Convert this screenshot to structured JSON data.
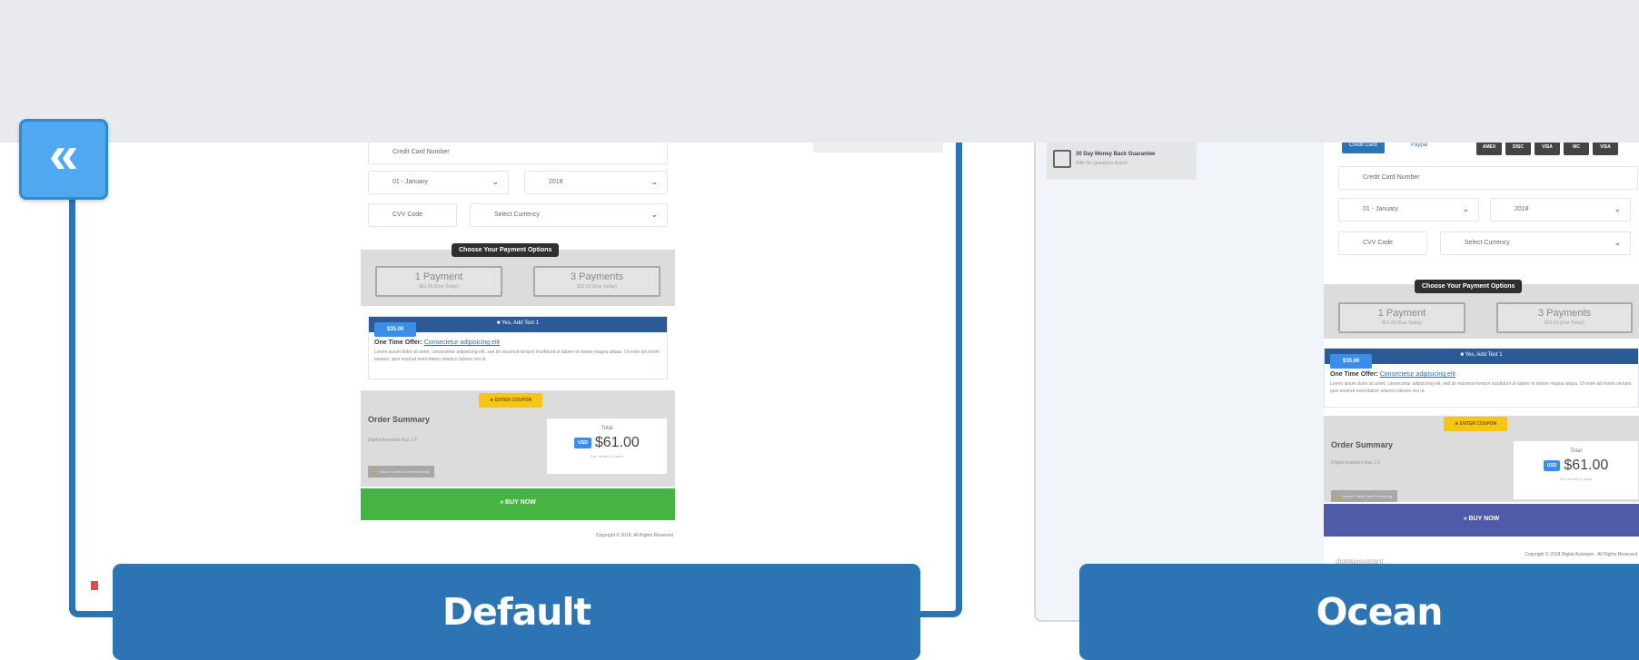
{
  "nav": {
    "back_icon": "«"
  },
  "themes": [
    {
      "name": "Default",
      "accent": "#2c74b4",
      "buy_color": "#45b443"
    },
    {
      "name": "Ocean",
      "accent": "#2c74b4",
      "buy_color": "#4f5aa8"
    }
  ],
  "checkout": {
    "card_number_placeholder": "Credit Card Number",
    "month_value": "01 - January",
    "year_value": "2018",
    "cvv_placeholder": "CVV Code",
    "currency_placeholder": "Select Currency",
    "payment_options_label": "Choose Your Payment Options",
    "payment_option_1": "1 Payment",
    "payment_option_1_sub": "$61.00 (Due Today)",
    "payment_option_2": "3 Payments",
    "payment_option_2_sub": "$20.33 (Due Today)",
    "offer_price": "$35.00",
    "offer_checkbox": "Yes, Add Test 1",
    "offer_title": "One Time Offer:",
    "offer_link": "Consectetur adipisicing elit",
    "offer_body": "Lorem ipsum dolor sit amet, consectetur adipisicing elit, sed do eiusmod tempor incididunt ut labore et dolore magna aliqua. Ut enim ad minim veniam, quis nostrud exercitation ullamco laboris nisi ut.",
    "coupon_label": "★ ENTER COUPON",
    "order_summary": "Order Summary",
    "order_item": "Digital Assistant App 1.0",
    "total_label": "Total",
    "currency_code": "USD",
    "total_amount": "$61.00",
    "total_note": "Incl. all fees & taxes",
    "secure_label": "🔒 Secure Credit Card Processing",
    "buy_now": "» BUY NOW",
    "copyright": "Copyright © 2018. All Rights Reserved",
    "copyright_ocean": "Copyright © 2018 Digital Assistant · All Rights Reserved",
    "credit_card_tab": "Credit Card",
    "paypal_tab": "Paypal",
    "card_logos": [
      "AMEX",
      "DISC",
      "VISA",
      "MC",
      "VISA"
    ]
  },
  "guarantee": {
    "title": "30 Day Money Back Guarantee",
    "subtitle": "With No Questions Asked"
  },
  "ocean_logo": "digitalassistant"
}
